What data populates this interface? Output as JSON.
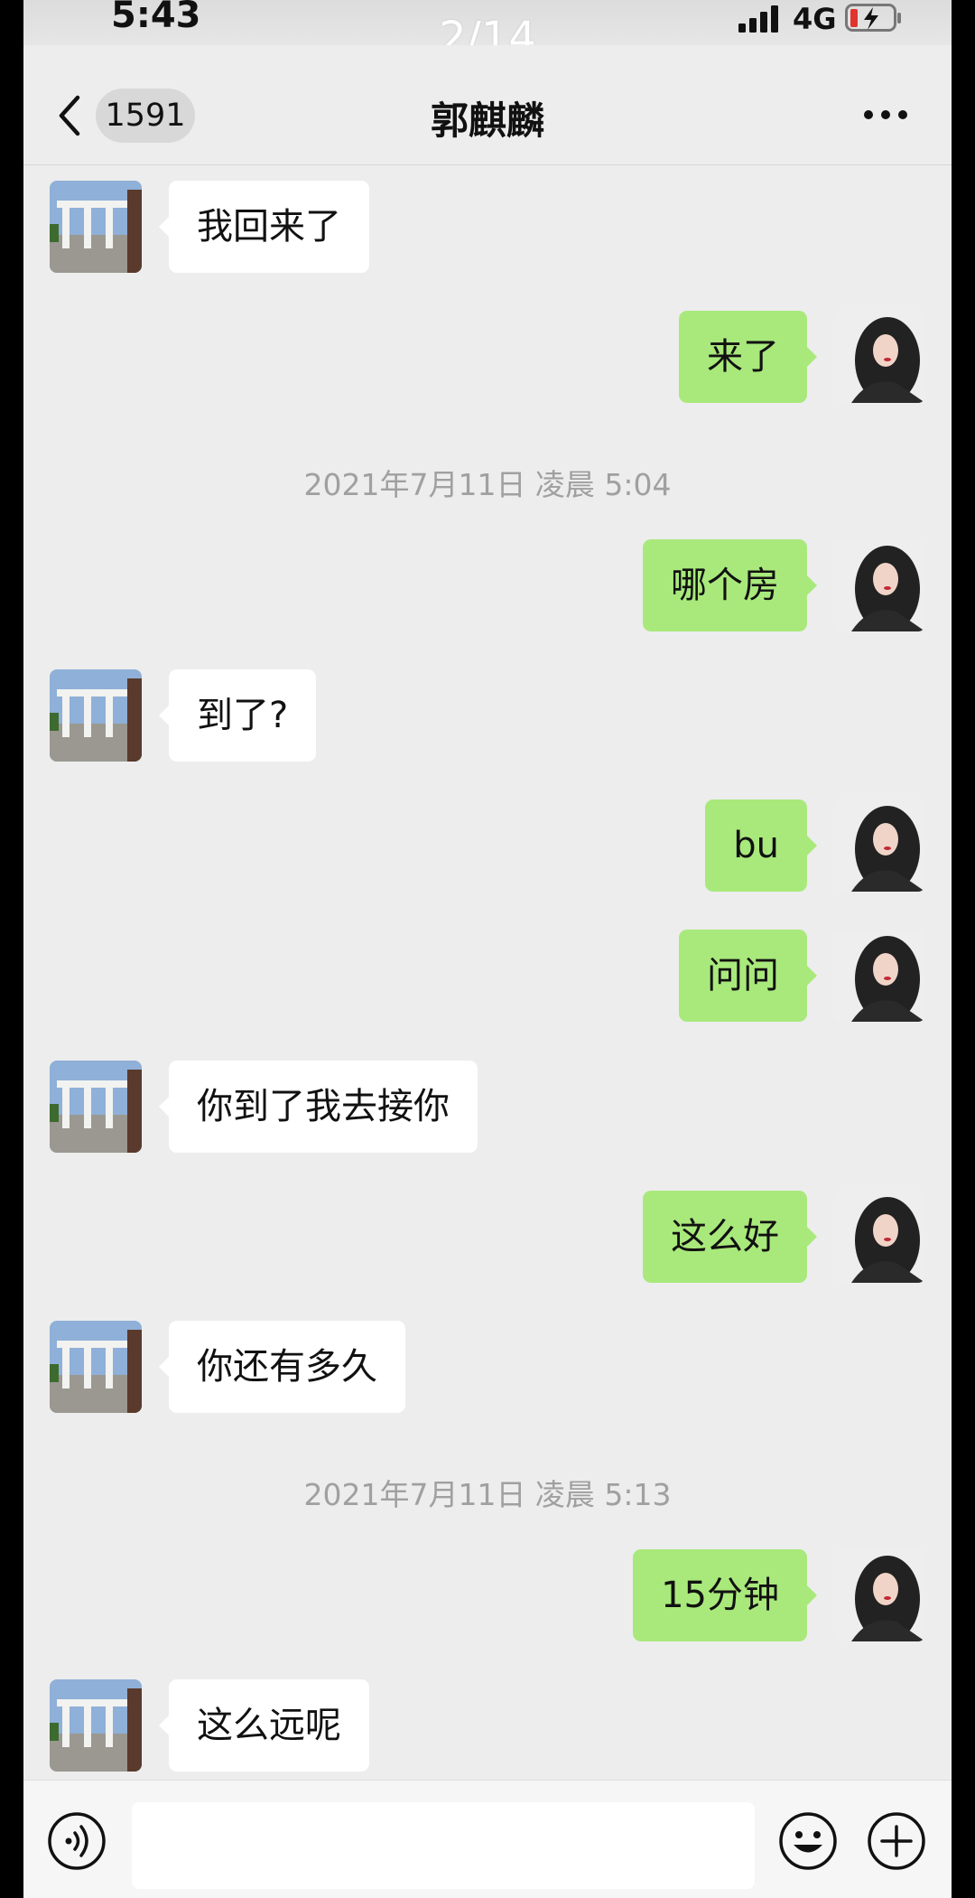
{
  "status_bar": {
    "time": "5:43",
    "network": "4G"
  },
  "pager": "2/14",
  "header": {
    "unread_count": "1591",
    "contact_name": "郭麒麟"
  },
  "messages": [
    {
      "side": "left",
      "text": "我回来了"
    },
    {
      "side": "right",
      "text": "来了"
    },
    {
      "timestamp": "2021年7月11日 凌晨 5:04"
    },
    {
      "side": "right",
      "text": "哪个房"
    },
    {
      "side": "left",
      "text": "到了?"
    },
    {
      "side": "right",
      "text": "bu"
    },
    {
      "side": "right",
      "text": "问问"
    },
    {
      "side": "left",
      "text": "你到了我去接你"
    },
    {
      "side": "right",
      "text": "这么好"
    },
    {
      "side": "left",
      "text": "你还有多久"
    },
    {
      "timestamp": "2021年7月11日 凌晨 5:13"
    },
    {
      "side": "right",
      "text": "15分钟"
    },
    {
      "side": "left",
      "text": "这么远呢"
    }
  ],
  "input_bar": {
    "icons": [
      "voice-icon",
      "emoji-icon",
      "plus-icon"
    ]
  },
  "colors": {
    "background": "#ededed",
    "outgoing_bubble": "#a9e97c",
    "incoming_bubble": "#ffffff"
  }
}
